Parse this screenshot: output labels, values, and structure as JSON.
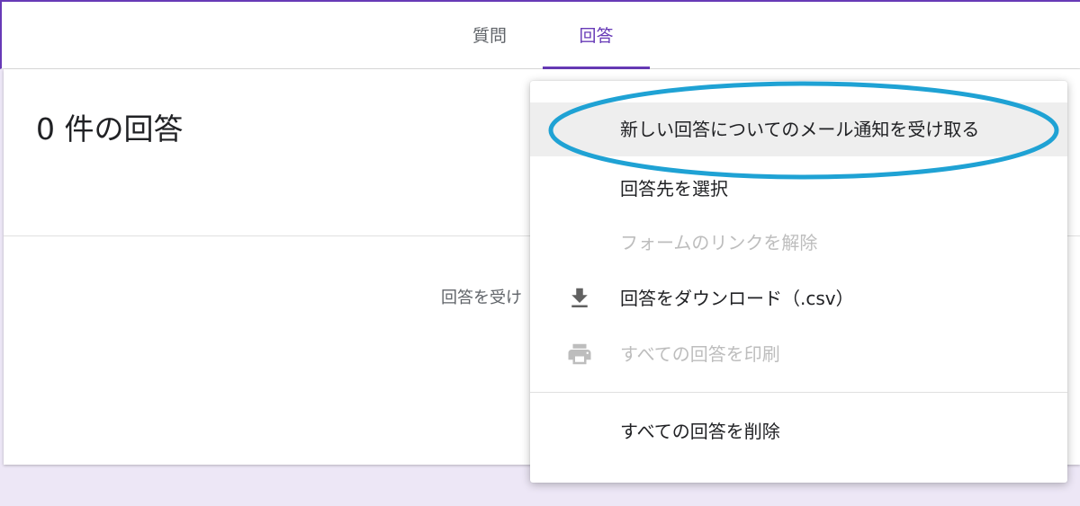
{
  "tabs": {
    "questions": "質問",
    "responses": "回答"
  },
  "responses_card": {
    "count_title": "0 件の回答",
    "accepting_text": "回答を受け"
  },
  "menu": {
    "items": [
      {
        "label": "新しい回答についてのメール通知を受け取る",
        "state": "highlighted",
        "icon": ""
      },
      {
        "label": "回答先を選択",
        "state": "enabled",
        "icon": ""
      },
      {
        "label": "フォームのリンクを解除",
        "state": "disabled",
        "icon": ""
      },
      {
        "label": "回答をダウンロード（.csv）",
        "state": "enabled",
        "icon": "download-icon"
      },
      {
        "label": "すべての回答を印刷",
        "state": "disabled",
        "icon": "print-icon"
      },
      {
        "label": "すべての回答を削除",
        "state": "enabled",
        "icon": ""
      }
    ]
  },
  "colors": {
    "accent": "#673ab7",
    "annotation": "#1fa2d4",
    "background": "#ede7f6",
    "disabled_text": "#bdbdbd",
    "hover": "#eeeeee"
  }
}
